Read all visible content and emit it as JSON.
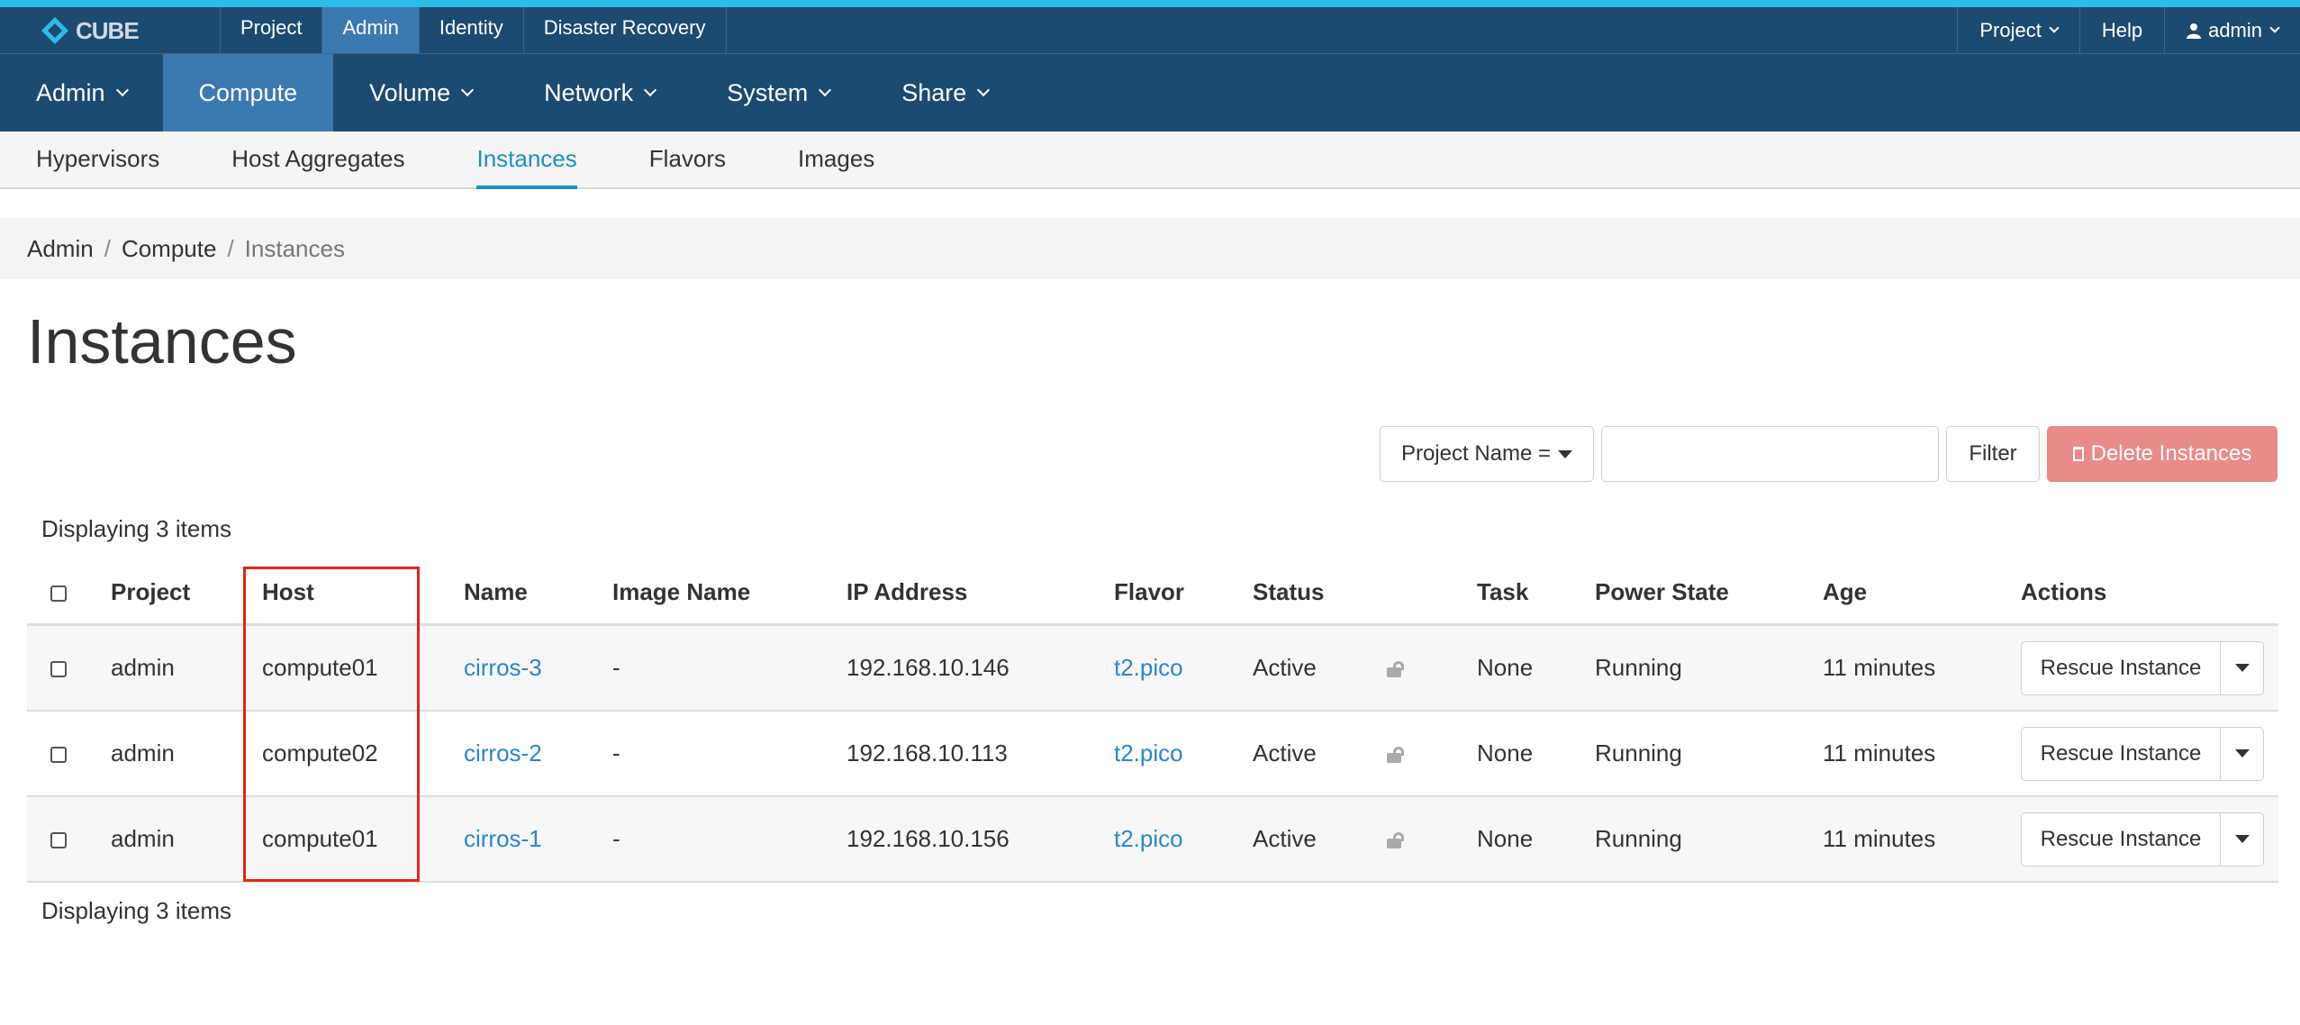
{
  "brand": {
    "logo_text": "CUBE",
    "accent": "#2bbde8",
    "nav_bg": "#1d4a6f",
    "active_bg": "#3b7ab0"
  },
  "topnav": {
    "items": [
      "Project",
      "Admin",
      "Identity",
      "Disaster Recovery"
    ],
    "active": "Admin"
  },
  "topright": {
    "project": "Project",
    "help": "Help",
    "user": "admin"
  },
  "mainnav": {
    "items": [
      {
        "label": "Admin",
        "dropdown": true
      },
      {
        "label": "Compute",
        "dropdown": false,
        "active": true
      },
      {
        "label": "Volume",
        "dropdown": true
      },
      {
        "label": "Network",
        "dropdown": true
      },
      {
        "label": "System",
        "dropdown": true
      },
      {
        "label": "Share",
        "dropdown": true
      }
    ]
  },
  "subnav": {
    "items": [
      "Hypervisors",
      "Host Aggregates",
      "Instances",
      "Flavors",
      "Images"
    ],
    "active": "Instances"
  },
  "breadcrumb": {
    "items": [
      "Admin",
      "Compute",
      "Instances"
    ],
    "separator": "/"
  },
  "page": {
    "title": "Instances"
  },
  "filter": {
    "select_label": "Project Name =",
    "input_value": "",
    "filter_button": "Filter",
    "delete_button": "Delete Instances",
    "delete_color": "#e88b89"
  },
  "table": {
    "count_top": "Displaying 3 items",
    "count_bottom": "Displaying 3 items",
    "columns": [
      "Project",
      "Host",
      "Name",
      "Image Name",
      "IP Address",
      "Flavor",
      "Status",
      "",
      "Task",
      "Power State",
      "Age",
      "Actions"
    ],
    "rows": [
      {
        "project": "admin",
        "host": "compute01",
        "name": "cirros-3",
        "image": "-",
        "ip": "192.168.10.146",
        "flavor": "t2.pico",
        "status": "Active",
        "task": "None",
        "power": "Running",
        "age": "11 minutes",
        "action": "Rescue Instance"
      },
      {
        "project": "admin",
        "host": "compute02",
        "name": "cirros-2",
        "image": "-",
        "ip": "192.168.10.113",
        "flavor": "t2.pico",
        "status": "Active",
        "task": "None",
        "power": "Running",
        "age": "11 minutes",
        "action": "Rescue Instance"
      },
      {
        "project": "admin",
        "host": "compute01",
        "name": "cirros-1",
        "image": "-",
        "ip": "192.168.10.156",
        "flavor": "t2.pico",
        "status": "Active",
        "task": "None",
        "power": "Running",
        "age": "11 minutes",
        "action": "Rescue Instance"
      }
    ]
  },
  "highlight": {
    "column": "Host",
    "color": "#e0251b"
  }
}
